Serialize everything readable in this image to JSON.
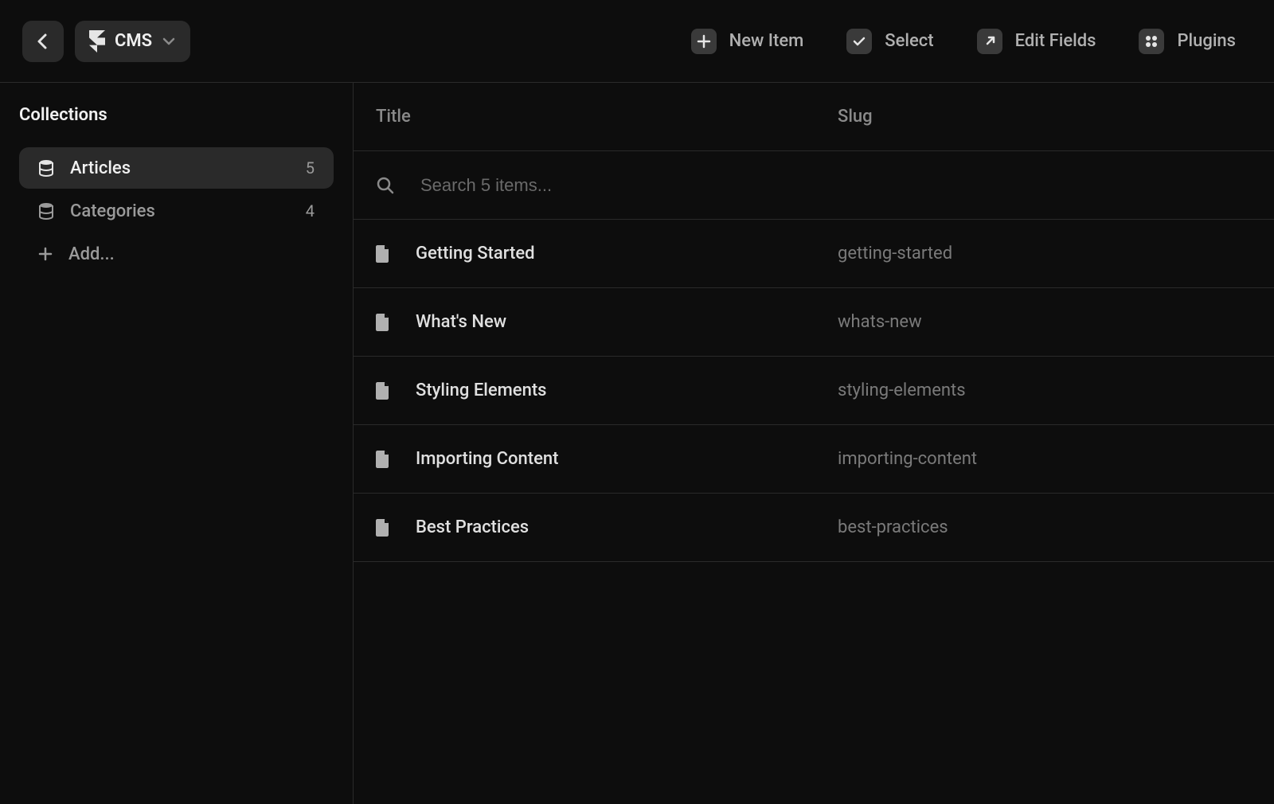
{
  "header": {
    "cms_label": "CMS"
  },
  "toolbar": {
    "new_item": "New Item",
    "select": "Select",
    "edit_fields": "Edit Fields",
    "plugins": "Plugins"
  },
  "sidebar": {
    "heading": "Collections",
    "collections": [
      {
        "label": "Articles",
        "count": "5",
        "active": true
      },
      {
        "label": "Categories",
        "count": "4",
        "active": false
      }
    ],
    "add_label": "Add..."
  },
  "columns": {
    "title": "Title",
    "slug": "Slug"
  },
  "search": {
    "placeholder": "Search 5 items..."
  },
  "items": [
    {
      "title": "Getting Started",
      "slug": "getting-started"
    },
    {
      "title": "What's New",
      "slug": "whats-new"
    },
    {
      "title": "Styling Elements",
      "slug": "styling-elements"
    },
    {
      "title": "Importing Content",
      "slug": "importing-content"
    },
    {
      "title": "Best Practices",
      "slug": "best-practices"
    }
  ]
}
